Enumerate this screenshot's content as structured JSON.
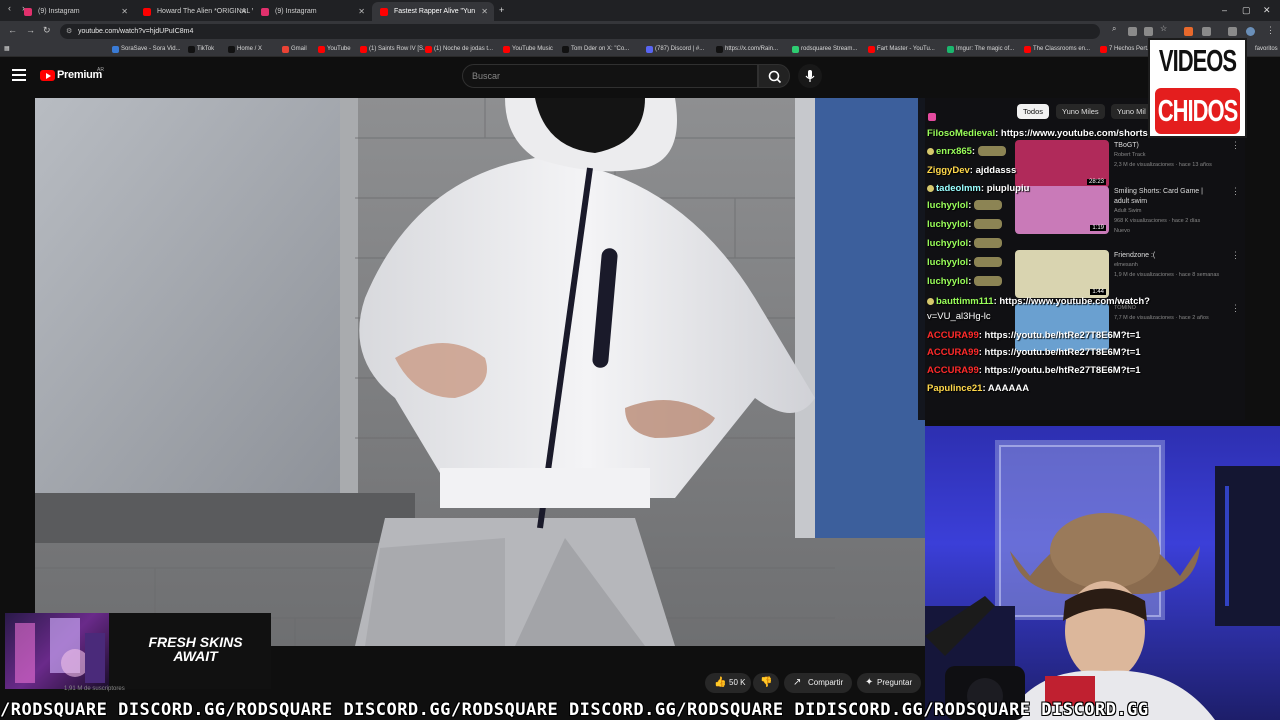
{
  "browser": {
    "tabs": [
      {
        "label": "(9) Instagram",
        "color": "#e1306c",
        "active": false
      },
      {
        "label": "Howard The Alien *ORIGINAL V",
        "color": "#ff0000",
        "active": false
      },
      {
        "label": "(9) Instagram",
        "color": "#e1306c",
        "active": false
      },
      {
        "label": "Fastest Rapper Alive \"Yun",
        "color": "#ff0000",
        "active": true
      }
    ],
    "new_tab": "+",
    "url": "youtube.com/watch?v=hjdUPuIC8m4",
    "bookmarks": [
      {
        "label": "SoraSave - Sora Vid...",
        "color": "#3a7bd5"
      },
      {
        "label": "TikTok",
        "color": "#111111"
      },
      {
        "label": "Home / X",
        "color": "#111111"
      },
      {
        "label": "Gmail",
        "color": "#ea4335"
      },
      {
        "label": "YouTube",
        "color": "#ff0000"
      },
      {
        "label": "(1) Saints Row IV [S...",
        "color": "#ff0000"
      },
      {
        "label": "(1) Noche de jodas t...",
        "color": "#ff0000"
      },
      {
        "label": "YouTube Music",
        "color": "#ff0000"
      },
      {
        "label": "Tom Dder on X: \"Co...",
        "color": "#111111"
      },
      {
        "label": "(787) Discord | #...",
        "color": "#5865f2"
      },
      {
        "label": "https://x.com/Rain...",
        "color": "#111111"
      },
      {
        "label": "rodsquaree Stream...",
        "color": "#2ecc71"
      },
      {
        "label": "Fart Master - YouTu...",
        "color": "#ff0000"
      },
      {
        "label": "Imgur: The magic of...",
        "color": "#1bb76e"
      },
      {
        "label": "The Classrooms en...",
        "color": "#ff0000"
      },
      {
        "label": "7 Hechos Pert...",
        "color": "#ff0000"
      }
    ],
    "bookmarks_end": "favoritos"
  },
  "youtube": {
    "brand": "Premium",
    "region": "AR",
    "search_placeholder": "Buscar",
    "subscribers": "1,91 M de suscriptores",
    "likes": "50 K",
    "share_label": "Compartir",
    "ask_label": "Preguntar",
    "chips": [
      "Todos",
      "Yuno Miles",
      "Yuno Mil"
    ],
    "recommendations": [
      {
        "title": "TBoGT)",
        "channel": "Robert Track",
        "meta": "2,3 M de visualizaciones · hace 13 años",
        "duration": "28:23",
        "color": "#b02a5a"
      },
      {
        "title": "Smiling Shorts: Card Game |",
        "title2": "adult swim",
        "channel": "Adult Swim",
        "meta": "968 K visualizaciones · hace 2 días",
        "extra": "Nuevo",
        "duration": "1:19",
        "color": "#c97ab8"
      },
      {
        "title": "Friendzone :(",
        "channel": "elmesanh",
        "meta": "1,9 M de visualizaciones · hace 8 semanas",
        "duration": "1:44",
        "color": "#d9d4b0"
      },
      {
        "title": "",
        "channel": "TOMINO",
        "meta": "7,7 M de visualizaciones · hace 2 años",
        "duration": "",
        "color": "#6aa0d0"
      }
    ]
  },
  "chat": [
    {
      "user": "FilosoMedieval",
      "msg": "https://www.youtube.com/shorts",
      "style": "green",
      "emote": false
    },
    {
      "user": "enrx865",
      "msg": "",
      "style": "green",
      "emote": true,
      "badge": true
    },
    {
      "user": "ZiggyDev",
      "msg": "ajddasss",
      "style": "yellow",
      "emote": false
    },
    {
      "user": "tadeolmm",
      "msg": "piuplupiu",
      "style": "cyan",
      "emote": false,
      "badge": true
    },
    {
      "user": "luchyylol",
      "msg": "",
      "style": "green",
      "emote": true
    },
    {
      "user": "luchyylol",
      "msg": "",
      "style": "green",
      "emote": true
    },
    {
      "user": "luchyylol",
      "msg": "",
      "style": "green",
      "emote": true
    },
    {
      "user": "luchyylol",
      "msg": "",
      "style": "green",
      "emote": true
    },
    {
      "user": "luchyylol",
      "msg": "",
      "style": "green",
      "emote": true
    },
    {
      "user": "bauttimm111",
      "msg": "https://www.youtube.com/watch?",
      "msg2": "v=VU_al3Hg-lc",
      "style": "green",
      "emote": false,
      "badge": true
    },
    {
      "user": "ACCURA99",
      "msg": "https://youtu.be/htRe27T8E6M?t=1",
      "style": "red",
      "emote": false
    },
    {
      "user": "ACCURA99",
      "msg": "https://youtu.be/htRe27T8E6M?t=1",
      "style": "red",
      "emote": false
    },
    {
      "user": "ACCURA99",
      "msg": "https://youtu.be/htRe27T8E6M?t=1",
      "style": "red",
      "emote": false
    },
    {
      "user": "Papulince21",
      "msg": "AAAAAA",
      "style": "yellow",
      "emote": false
    }
  ],
  "overlay": {
    "logo_top": "VIDEOS",
    "logo_bottom": "CHIDOS",
    "ad_line1": "FRESH SKINS",
    "ad_line2": "AWAIT",
    "ticker": "/RODSQUARE DISCORD.GG/RODSQUARE DISCORD.GG/RODSQUARE DISCORD.GG/RODSQUARE DIDISCORD.GG/RODSQUARE DISCORD.GG"
  }
}
